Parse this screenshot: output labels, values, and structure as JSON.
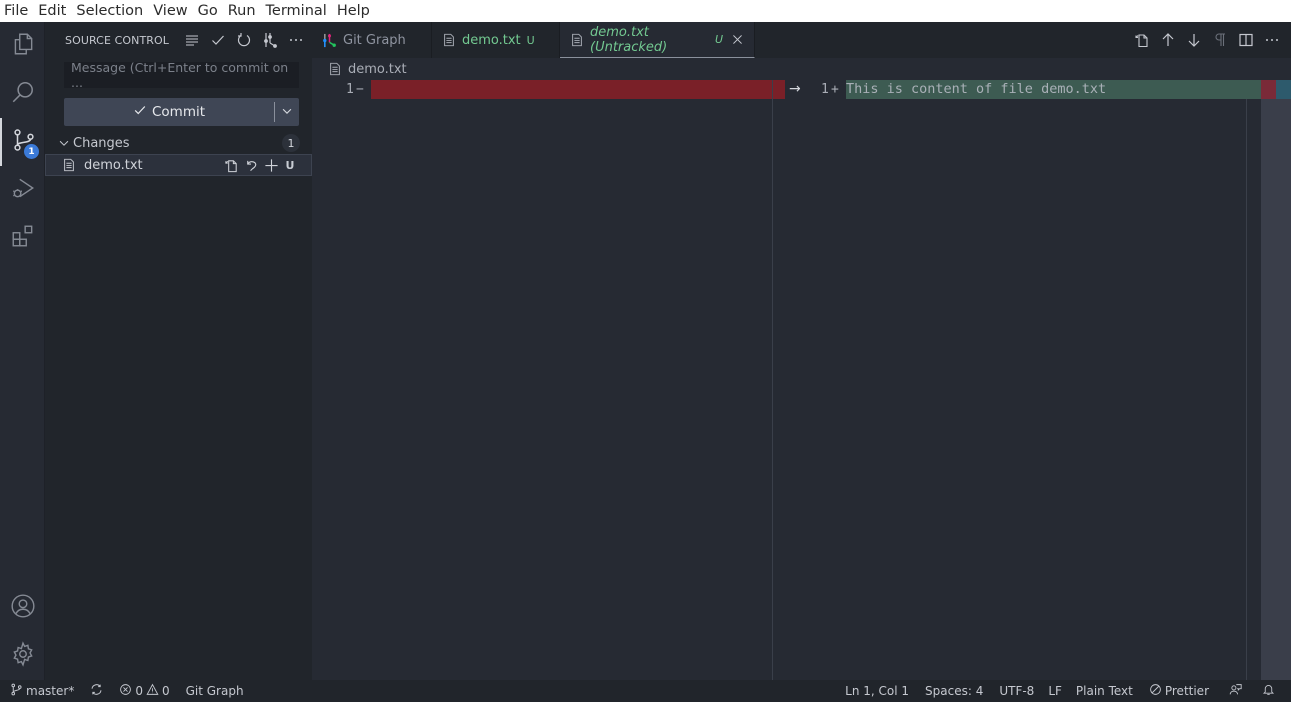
{
  "menu": [
    "File",
    "Edit",
    "Selection",
    "View",
    "Go",
    "Run",
    "Terminal",
    "Help"
  ],
  "activity_bar": {
    "items": [
      {
        "name": "explorer",
        "icon": "files-icon"
      },
      {
        "name": "search",
        "icon": "search-icon"
      },
      {
        "name": "source-control",
        "icon": "source-control-icon",
        "badge": "1",
        "active": true
      },
      {
        "name": "run-debug",
        "icon": "run-debug-icon"
      },
      {
        "name": "extensions",
        "icon": "extensions-icon"
      }
    ],
    "bottom": [
      {
        "name": "accounts",
        "icon": "account-icon"
      },
      {
        "name": "manage",
        "icon": "gear-icon"
      }
    ]
  },
  "sidebar": {
    "title": "SOURCE CONTROL",
    "actions": [
      "view-as-tree-icon",
      "commit-check-icon",
      "refresh-icon",
      "git-graph-icon",
      "more-actions-icon"
    ],
    "message_placeholder": "Message (Ctrl+Enter to commit on ...",
    "commit_label": "Commit",
    "changes": {
      "label": "Changes",
      "count": "1",
      "files": [
        {
          "name": "demo.txt",
          "status": "U"
        }
      ]
    }
  },
  "tabs": [
    {
      "label": "Git Graph",
      "icon": "git-graph-icon",
      "active": false
    },
    {
      "label": "demo.txt",
      "badge": "U",
      "icon": "file-icon",
      "active": false
    },
    {
      "label": "demo.txt (Untracked)",
      "badge": "U",
      "icon": "file-icon",
      "active": true
    }
  ],
  "editor_actions": [
    "open-file-icon",
    "previous-change-icon",
    "next-change-icon",
    "show-whitespace-icon",
    "split-editor-icon",
    "more-actions-icon"
  ],
  "breadcrumb": {
    "file": "demo.txt"
  },
  "diff": {
    "left": {
      "line_number": "1",
      "marker": "−",
      "content": ""
    },
    "right": {
      "line_number": "1",
      "marker": "+",
      "content": "This is content of file demo.txt"
    }
  },
  "colors": {
    "deleted": "#7a2028",
    "inserted": "#3d5b52",
    "untracked_text": "#73c991",
    "badge": "#3b7ad8"
  },
  "status_bar": {
    "branch": "master*",
    "errors": "0",
    "warnings": "0",
    "git_graph": "Git Graph",
    "position": "Ln 1, Col 1",
    "spaces": "Spaces: 4",
    "encoding": "UTF-8",
    "eol": "LF",
    "language": "Plain Text",
    "prettier": "Prettier"
  }
}
